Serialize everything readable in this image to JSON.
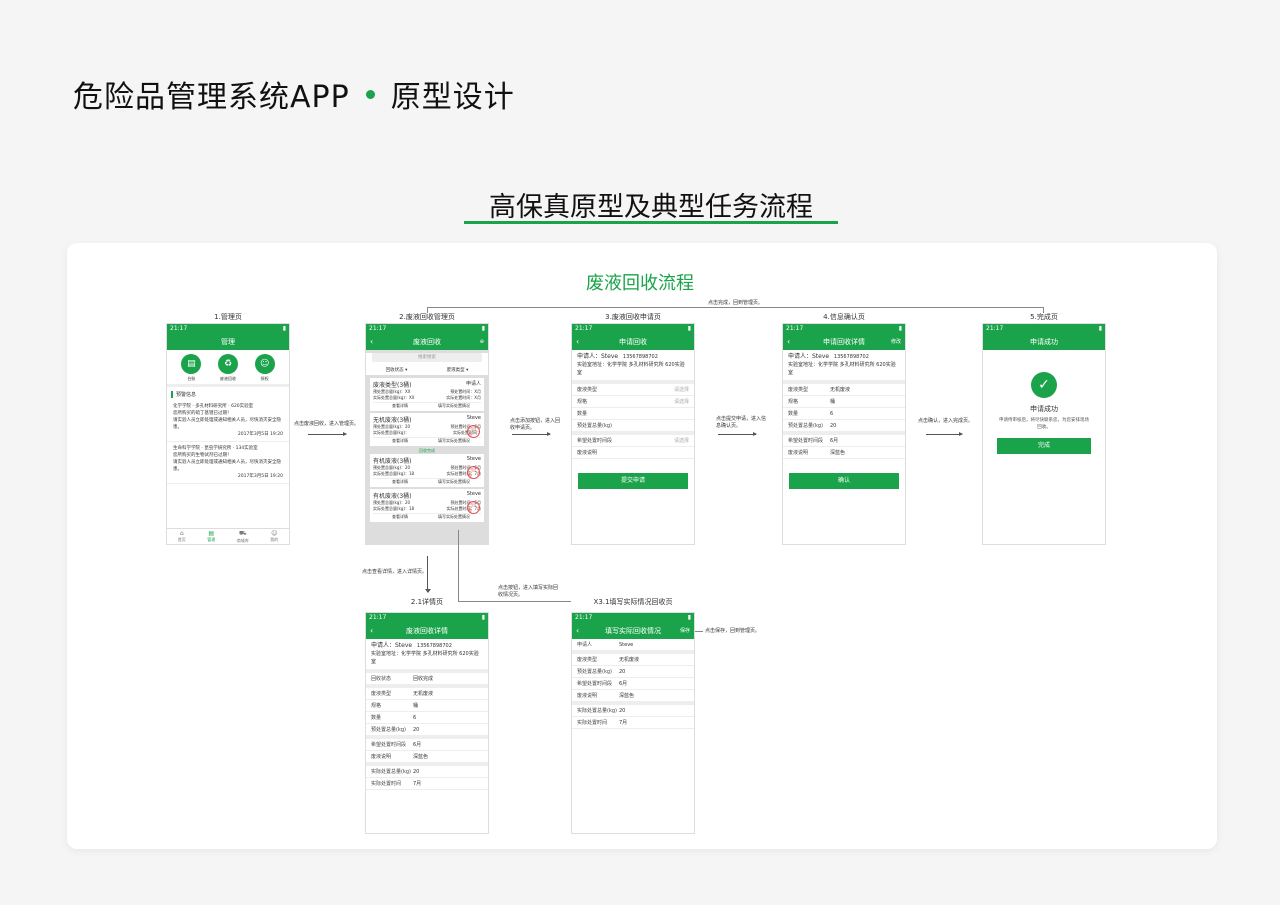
{
  "header": {
    "title_left": "危险品管理系统APP",
    "title_right": "原型设计"
  },
  "subtitle": "高保真原型及典型任务流程",
  "flow_title": "废液回收流程",
  "status_time": "21:17",
  "screens": {
    "s1": {
      "label": "1.管理页",
      "nav": "管理",
      "icons": [
        "台账",
        "废液回收",
        "授权"
      ],
      "warn": "预警信息",
      "msgs": [
        {
          "l1": "化学学院 · 多孔材料研究所 · 620实验室",
          "l2": "您所购买的硫丁基锂已过期！",
          "l3": "请实验人员立即处理或通知相关人员，尽快消灭安全隐患。",
          "date": "2017年3月5日 19:20"
        },
        {
          "l1": "生命科学学院 · 昆虫学研究所 · 134实验室",
          "l2": "您所购买的生物试剂已过期！",
          "l3": "请实验人员立即处理或通知相关人员，尽快消灭安全隐患。",
          "date": "2017年3月5日 19:20"
        }
      ],
      "tabs": [
        "首页",
        "管理",
        "商城库",
        "我的"
      ]
    },
    "s2": {
      "label": "2.废液回收管理页",
      "nav": "废液回收",
      "search": "搜索搜索",
      "filter1": "回收状态 ▾",
      "filter2": "废液类型 ▾",
      "items": [
        {
          "name": "废液类型",
          "qty": "(3桶)",
          "person": "申请人",
          "l1a": "预处置总量(kg)：XX",
          "l1b": "预处置时间：X月",
          "l2a": "实际处置总量(kg)：XX",
          "l2b": "实际处置时间：X月",
          "act1": "查看详情",
          "act2": "填写实际处置情况"
        },
        {
          "name": "无机废液",
          "qty": "(3桶)",
          "person": "Steve",
          "l1a": "预处置总量(kg)：20",
          "l1b": "预处置时间：6月",
          "l2a": "实际处置总量(kg)：",
          "l2b": "实际处置时间：",
          "act1": "查看详情",
          "act2": "填写实际处置情况"
        },
        {
          "name": "有机废液",
          "qty": "(3桶)",
          "person": "Steve",
          "l1a": "预处置总量(kg)：20",
          "l1b": "预处置时间：6月",
          "l2a": "实际处置总量(kg)：18",
          "l2b": "实际处置时间：7月",
          "act1": "查看详情",
          "act2": "填写实际处置情况"
        },
        {
          "name": "有机废液",
          "qty": "(3桶)",
          "person": "Steve",
          "l1a": "预处置总量(kg)：20",
          "l1b": "预处置时间：6月",
          "l2a": "实际处置总量(kg)：18",
          "l2b": "实际处置时间：7月",
          "act1": "查看详情",
          "act2": "填写实际处置情况"
        }
      ],
      "done_sep": "回收完成",
      "stamp": "已回收"
    },
    "s3": {
      "label": "3.废液回收申请页",
      "nav": "申请回收",
      "applicant": "申请人：Steve",
      "phone": "13567898702",
      "addr": "实验室地址：化学学院 多孔材料研究所 620实验室",
      "rows": [
        {
          "k": "废液类型",
          "v": "请选择"
        },
        {
          "k": "规格",
          "v": "请选择"
        },
        {
          "k": "数量",
          "v": ""
        },
        {
          "k": "预处置总量(kg)",
          "v": ""
        },
        {
          "k": "希望处置时间段",
          "v": "请选择"
        },
        {
          "k": "废液说明",
          "v": ""
        }
      ],
      "button": "提交申请"
    },
    "s4": {
      "label": "4.信息确认页",
      "nav": "申请回收详情",
      "nav_right": "修改",
      "applicant": "申请人：Steve",
      "phone": "13567898702",
      "addr": "实验室地址：化学学院 多孔材料研究所 620实验室",
      "rows": [
        {
          "k": "废液类型",
          "v": "无机废液"
        },
        {
          "k": "规格",
          "v": "桶"
        },
        {
          "k": "数量",
          "v": "6"
        },
        {
          "k": "预处置总量(kg)",
          "v": "20"
        },
        {
          "k": "希望处置时间段",
          "v": "6月"
        },
        {
          "k": "废液说明",
          "v": "深蓝色"
        }
      ],
      "button": "确认"
    },
    "s5": {
      "label": "5.完成页",
      "nav": "申请成功",
      "title": "申请成功",
      "desc": "申请侍审核后，将尽快联系您，为您安排现场回收。",
      "button": "完成"
    },
    "s21": {
      "label": "2.1详情页",
      "nav": "废液回收详情",
      "applicant": "申请人：Steve",
      "phone": "13567898702",
      "addr": "实验室地址：化学学院 多孔材料研究所 620实验室",
      "rows": [
        {
          "k": "回收状态",
          "v": "回收完成"
        },
        {
          "k": "废液类型",
          "v": "无机废液"
        },
        {
          "k": "规格",
          "v": "桶"
        },
        {
          "k": "数量",
          "v": "6"
        },
        {
          "k": "预处置总量(kg)",
          "v": "20"
        },
        {
          "k": "希望处置时间段",
          "v": "6月"
        },
        {
          "k": "废液说明",
          "v": "深蓝色"
        },
        {
          "k": "实际处置总量(kg)",
          "v": "20"
        },
        {
          "k": "实际处置时间",
          "v": "7月"
        }
      ]
    },
    "s31": {
      "label": "X3.1填写实际情况回收页",
      "nav": "填写实际回收情况",
      "nav_right": "保存",
      "rows": [
        {
          "k": "申请人",
          "v": "Steve"
        },
        {
          "k": "废液类型",
          "v": "无机废液"
        },
        {
          "k": "预处置总量(kg)",
          "v": "20"
        },
        {
          "k": "希望处置时间段",
          "v": "6月"
        },
        {
          "k": "废液说明",
          "v": "深蓝色"
        },
        {
          "k": "实际处置总量(kg)",
          "v": "20"
        },
        {
          "k": "实际处置时间",
          "v": "7月"
        }
      ]
    }
  },
  "annotations": {
    "a1": "点击废液回收，进入管理页。",
    "a2": "点击添加按钮，进入回收申请页。",
    "a3": "点击提交申请，进入信息确认页。",
    "a4": "点击确认，进入完成页。",
    "a5": "点击完成，回到管理页。",
    "a6": "点击查看详情，进入详情页。",
    "a7": "点击按钮，进入填写实际回收情况页。",
    "a8": "点击保存，回到管理页。"
  }
}
